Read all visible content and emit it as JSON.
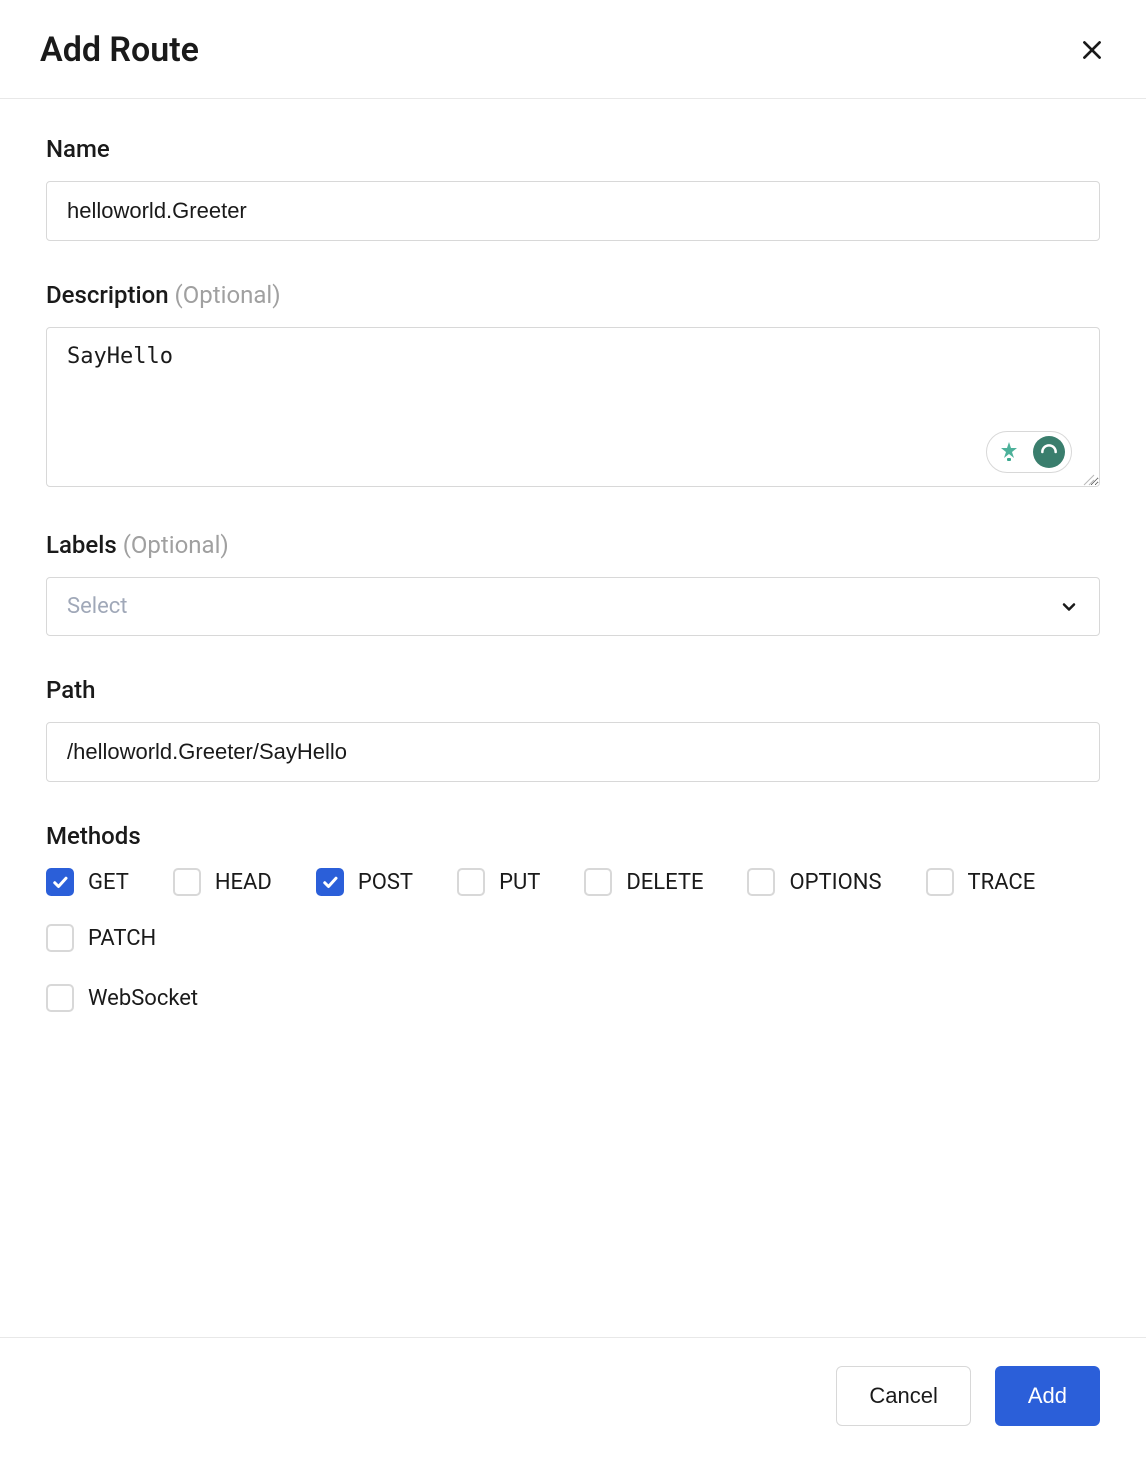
{
  "dialog": {
    "title": "Add Route"
  },
  "fields": {
    "name": {
      "label": "Name",
      "value": "helloworld.Greeter"
    },
    "description": {
      "label": "Description",
      "optional": "(Optional)",
      "value": "SayHello"
    },
    "labels": {
      "label": "Labels",
      "optional": "(Optional)",
      "placeholder": "Select"
    },
    "path": {
      "label": "Path",
      "value": "/helloworld.Greeter/SayHello"
    },
    "methods": {
      "label": "Methods",
      "items": [
        {
          "label": "GET",
          "checked": true
        },
        {
          "label": "HEAD",
          "checked": false
        },
        {
          "label": "POST",
          "checked": true
        },
        {
          "label": "PUT",
          "checked": false
        },
        {
          "label": "DELETE",
          "checked": false
        },
        {
          "label": "OPTIONS",
          "checked": false
        },
        {
          "label": "TRACE",
          "checked": false
        },
        {
          "label": "PATCH",
          "checked": false
        }
      ]
    },
    "websocket": {
      "label": "WebSocket",
      "checked": false
    }
  },
  "footer": {
    "cancel": "Cancel",
    "add": "Add"
  }
}
